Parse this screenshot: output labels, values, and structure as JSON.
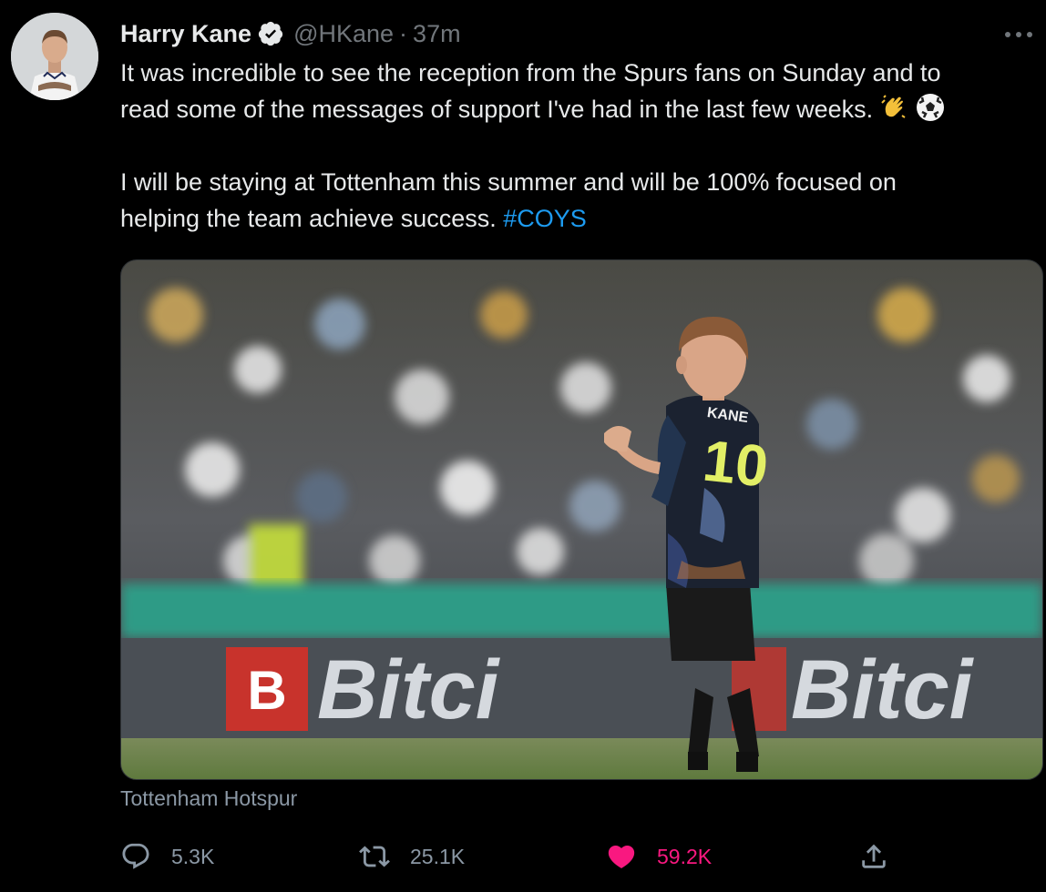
{
  "tweet": {
    "author": {
      "display_name": "Harry Kane",
      "handle": "@HKane",
      "separator": "·",
      "time": "37m",
      "verified": true
    },
    "text": {
      "line1": "It was incredible to see the reception from the Spurs fans on Sunday and to",
      "line2": "read some of the messages of support I've had in the last few weeks.",
      "line3": "I will be staying at Tottenham this summer and will be 100% focused on",
      "line4": "helping the team achieve success.",
      "hashtag": "#COYS",
      "emojis": [
        "clapping-hands-emoji",
        "soccer-ball-emoji"
      ]
    },
    "media": {
      "caption": "Tottenham Hotspur",
      "shirt_name": "KANE",
      "shirt_number": "10",
      "board_text": "Bitci"
    },
    "actions": {
      "replies": "5.3K",
      "retweets": "25.1K",
      "likes": "59.2K",
      "liked": true
    }
  },
  "icons": {
    "verified": "verified-badge-icon",
    "more": "more-options-icon",
    "reply": "reply-icon",
    "retweet": "retweet-icon",
    "like": "heart-icon",
    "share": "share-icon"
  },
  "colors": {
    "background": "#000000",
    "text": "#e7e9ea",
    "muted": "#71767b",
    "link": "#1d9bf0",
    "like": "#f91880"
  }
}
